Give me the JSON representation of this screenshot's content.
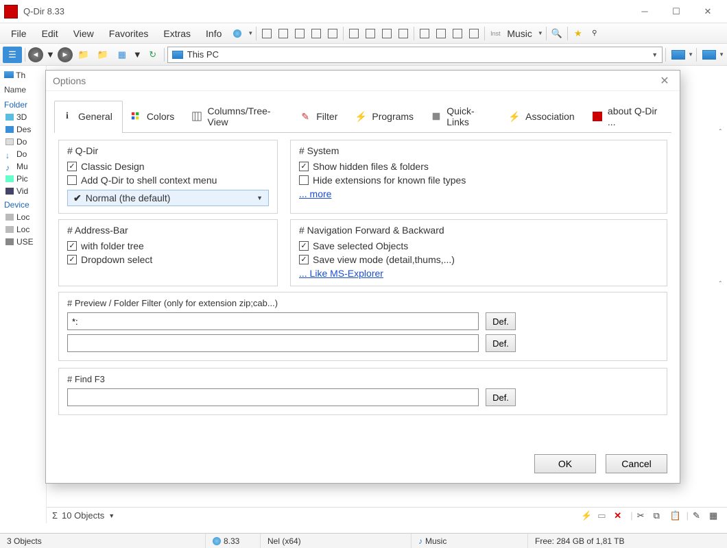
{
  "window": {
    "title": "Q-Dir 8.33"
  },
  "menubar": {
    "items": [
      "File",
      "Edit",
      "View",
      "Favorites",
      "Extras",
      "Info"
    ],
    "music_label": "Music"
  },
  "navbar": {
    "address": "This PC"
  },
  "sidebar": {
    "tab_label": "Th",
    "name_header": "Name",
    "group_folders": "Folder",
    "folder_items": [
      "3D",
      "Des",
      "Do",
      "Do",
      "Mu",
      "Pic",
      "Vid"
    ],
    "group_devices": "Device",
    "device_items": [
      "Loc",
      "Loc",
      "USE"
    ]
  },
  "objects_bar": {
    "label": "10 Objects",
    "sigma": "Σ"
  },
  "statusbar": {
    "objects": "3 Objects",
    "version": "8.33",
    "build": "Nel (x64)",
    "music": "Music",
    "free": "Free: 284 GB of 1,81 TB"
  },
  "dialog": {
    "title": "Options",
    "tabs": [
      "General",
      "Colors",
      "Columns/Tree-View",
      "Filter",
      "Programs",
      "Quick-Links",
      "Association",
      "about Q-Dir ..."
    ],
    "groups": {
      "qdir": {
        "legend": "# Q-Dir",
        "classic_design": "Classic Design",
        "add_shell": "Add Q-Dir to shell context menu",
        "dropdown_value": "Normal (the default)"
      },
      "system": {
        "legend": "# System",
        "show_hidden": "Show hidden files & folders",
        "hide_ext": "Hide extensions for known file types",
        "more": "... more"
      },
      "address": {
        "legend": "# Address-Bar",
        "folder_tree": "with folder tree",
        "dropdown_select": "Dropdown select"
      },
      "nav": {
        "legend": "# Navigation Forward & Backward",
        "save_objects": "Save selected Objects",
        "save_view": "Save view mode (detail,thums,...)",
        "like_explorer": "... Like MS-Explorer"
      },
      "preview": {
        "legend": "# Preview / Folder Filter (only for extension zip;cab...)",
        "value1": "*:",
        "value2": "",
        "def": "Def."
      },
      "find": {
        "legend": "# Find   F3",
        "value": "",
        "def": "Def."
      }
    },
    "buttons": {
      "ok": "OK",
      "cancel": "Cancel"
    }
  }
}
